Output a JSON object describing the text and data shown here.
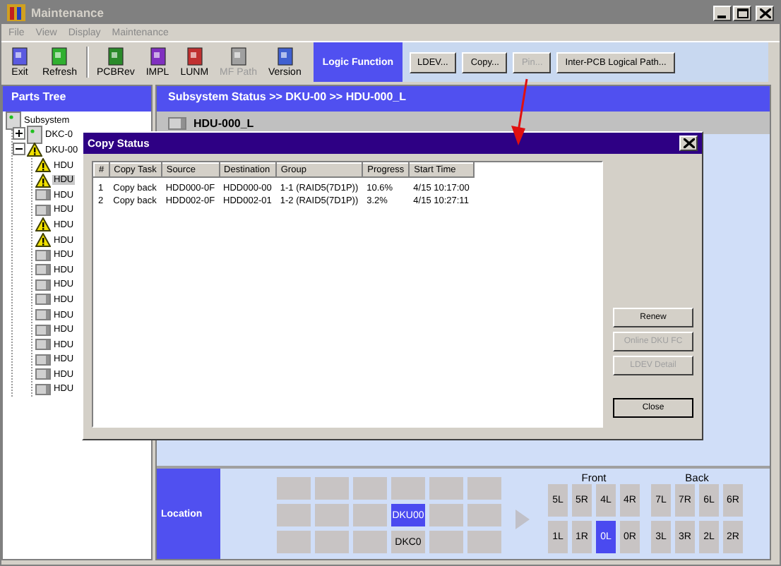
{
  "window": {
    "title": "Maintenance"
  },
  "menu": [
    "File",
    "View",
    "Display",
    "Maintenance"
  ],
  "toolbar": [
    {
      "label": "Exit",
      "disabled": false
    },
    {
      "label": "Refresh",
      "disabled": false
    },
    {
      "label": "PCBRev",
      "disabled": false
    },
    {
      "label": "IMPL",
      "disabled": false
    },
    {
      "label": "LUNM",
      "disabled": false
    },
    {
      "label": "MF Path",
      "disabled": true
    },
    {
      "label": "Version",
      "disabled": false
    }
  ],
  "function_bar": {
    "label": "Logic Function",
    "buttons": [
      {
        "label": "LDEV...",
        "disabled": false
      },
      {
        "label": "Copy...",
        "disabled": false
      },
      {
        "label": "Pin...",
        "disabled": true
      },
      {
        "label": "Inter-PCB Logical Path...",
        "disabled": false
      }
    ]
  },
  "parts_tree": {
    "title": "Parts Tree",
    "items": [
      {
        "label": "Subsystem",
        "kind": "cabinet",
        "warning": false,
        "selected": false,
        "children": [
          {
            "label": "DKC-0",
            "kind": "cabinet",
            "warning": false,
            "selected": false,
            "expanded": false
          },
          {
            "label": "DKU-00",
            "warning": true,
            "selected": false,
            "expanded": true,
            "children": [
              {
                "label": "HDU",
                "warning": true,
                "selected": false
              },
              {
                "label": "HDU",
                "warning": true,
                "selected": true
              },
              {
                "label": "HDU",
                "kind": "drive",
                "warning": false,
                "selected": false
              },
              {
                "label": "HDU",
                "kind": "drive",
                "warning": false,
                "selected": false
              },
              {
                "label": "HDU",
                "warning": true,
                "selected": false
              },
              {
                "label": "HDU",
                "warning": true,
                "selected": false
              },
              {
                "label": "HDU",
                "kind": "drive",
                "warning": false,
                "selected": false
              },
              {
                "label": "HDU",
                "kind": "drive",
                "warning": false,
                "selected": false
              },
              {
                "label": "HDU",
                "kind": "drive",
                "warning": false,
                "selected": false
              },
              {
                "label": "HDU",
                "kind": "drive",
                "warning": false,
                "selected": false
              },
              {
                "label": "HDU",
                "kind": "drive",
                "warning": false,
                "selected": false
              },
              {
                "label": "HDU",
                "kind": "drive",
                "warning": false,
                "selected": false
              },
              {
                "label": "HDU",
                "kind": "drive",
                "warning": false,
                "selected": false
              },
              {
                "label": "HDU",
                "kind": "drive",
                "warning": false,
                "selected": false
              },
              {
                "label": "HDU",
                "kind": "drive",
                "warning": false,
                "selected": false
              },
              {
                "label": "HDU",
                "kind": "drive",
                "warning": false,
                "selected": false
              }
            ]
          }
        ]
      }
    ]
  },
  "status_panel": {
    "breadcrumb": "Subsystem Status >> DKU-00 >> HDU-000_L",
    "item": "HDU-000_L"
  },
  "copy_status_dialog": {
    "title": "Copy Status",
    "columns": [
      "#",
      "Copy Task",
      "Source",
      "Destination",
      "Group",
      "Progress",
      "Start Time"
    ],
    "rows": [
      [
        "1",
        "Copy back",
        "HDD000-0F",
        "HDD000-00",
        "1-1 (RAID5(7D1P))",
        "10.6%",
        "4/15  10:17:00"
      ],
      [
        "2",
        "Copy back",
        "HDD002-0F",
        "HDD002-01",
        "1-2 (RAID5(7D1P))",
        "3.2%",
        "4/15  10:27:11"
      ]
    ],
    "buttons": [
      {
        "label": "Renew",
        "disabled": false
      },
      {
        "label": "Online DKU FC",
        "disabled": true
      },
      {
        "label": "LDEV Detail",
        "disabled": true
      },
      {
        "label": "Close",
        "disabled": false
      }
    ]
  },
  "location": {
    "label": "Location",
    "grid": [
      [
        {
          "selected": false
        },
        {
          "selected": false
        },
        {
          "selected": false
        },
        {
          "selected": false
        },
        {
          "selected": false
        },
        {
          "selected": false
        }
      ],
      [
        {
          "selected": false
        },
        {
          "selected": false
        },
        {
          "selected": false
        },
        {
          "label": "DKU00",
          "selected": true
        },
        {
          "selected": false
        },
        {
          "selected": false
        }
      ],
      [
        {
          "selected": false
        },
        {
          "selected": false
        },
        {
          "selected": false
        },
        {
          "label": "DKC0",
          "selected": false
        },
        {
          "selected": false
        },
        {
          "selected": false
        }
      ]
    ],
    "groups": [
      {
        "label": "Front",
        "cells": [
          [
            {
              "label": "5L",
              "selected": false
            },
            {
              "label": "5R",
              "selected": false
            },
            {
              "label": "4L",
              "selected": false
            },
            {
              "label": "4R",
              "selected": false
            }
          ],
          [
            {
              "label": "1L",
              "selected": false
            },
            {
              "label": "1R",
              "selected": false
            },
            {
              "label": "0L",
              "selected": true
            },
            {
              "label": "0R",
              "selected": false
            }
          ]
        ]
      },
      {
        "label": "Back",
        "cells": [
          [
            {
              "label": "7L",
              "selected": false
            },
            {
              "label": "7R",
              "selected": false
            },
            {
              "label": "6L",
              "selected": false
            },
            {
              "label": "6R",
              "selected": false
            }
          ],
          [
            {
              "label": "3L",
              "selected": false
            },
            {
              "label": "3R",
              "selected": false
            },
            {
              "label": "2L",
              "selected": false
            },
            {
              "label": "2R",
              "selected": false
            }
          ]
        ]
      }
    ]
  }
}
